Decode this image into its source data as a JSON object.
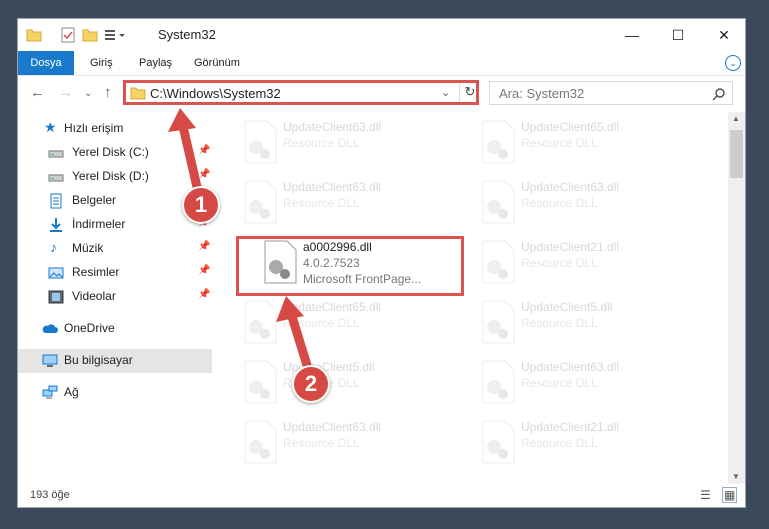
{
  "window": {
    "title": "System32"
  },
  "ribbon": {
    "tabs": [
      "Dosya",
      "Giriş",
      "Paylaş",
      "Görünüm"
    ]
  },
  "address": {
    "path": "C:\\Windows\\System32"
  },
  "search": {
    "placeholder": "Ara: System32"
  },
  "sidebar": {
    "items": [
      {
        "label": "Hızlı erişim",
        "icon": "star-icon"
      },
      {
        "label": "Yerel Disk (C:)",
        "icon": "drive-icon"
      },
      {
        "label": "Yerel Disk (D:)",
        "icon": "drive-icon"
      },
      {
        "label": "Belgeler",
        "icon": "documents-icon"
      },
      {
        "label": "İndirmeler",
        "icon": "download-icon"
      },
      {
        "label": "Müzik",
        "icon": "music-icon"
      },
      {
        "label": "Resimler",
        "icon": "pictures-icon"
      },
      {
        "label": "Videolar",
        "icon": "videos-icon"
      },
      {
        "label": "OneDrive",
        "icon": "cloud-icon"
      },
      {
        "label": "Bu bilgisayar",
        "icon": "computer-icon"
      },
      {
        "label": "Ağ",
        "icon": "network-icon"
      }
    ]
  },
  "files": [
    {
      "name": "UpdateClient63.dll",
      "desc": "Resource DLL"
    },
    {
      "name": "UpdateClient65.dll",
      "desc": "Resource DLL"
    },
    {
      "name": "UpdateClient63.dll",
      "desc": "Resource DLL"
    },
    {
      "name": "UpdateClient63.dll",
      "desc": "Resource DLL"
    },
    {
      "name": "a0002996.dll",
      "version": "4.0.2.7523",
      "desc": "Microsoft FrontPage..."
    },
    {
      "name": "UpdateClient21.dll",
      "desc": "Resource DLL"
    },
    {
      "name": "UpdateClient65.dll",
      "desc": "Resource DLL"
    },
    {
      "name": "UpdateClient5.dll",
      "desc": "Resource DLL"
    },
    {
      "name": "UpdateClient5.dll",
      "desc": "Resource DLL"
    },
    {
      "name": "UpdateClient63.dll",
      "desc": "Resource DLL"
    },
    {
      "name": "UpdateClient63.dll",
      "desc": "Resource DLL"
    },
    {
      "name": "UpdateClient21.dll",
      "desc": "Resource DLL"
    }
  ],
  "status": {
    "count": "193 öğe"
  },
  "annotations": {
    "step1": "1",
    "step2": "2"
  },
  "colors": {
    "accent": "#1979ca",
    "highlight": "#d9534f",
    "badge": "#d64a45"
  }
}
